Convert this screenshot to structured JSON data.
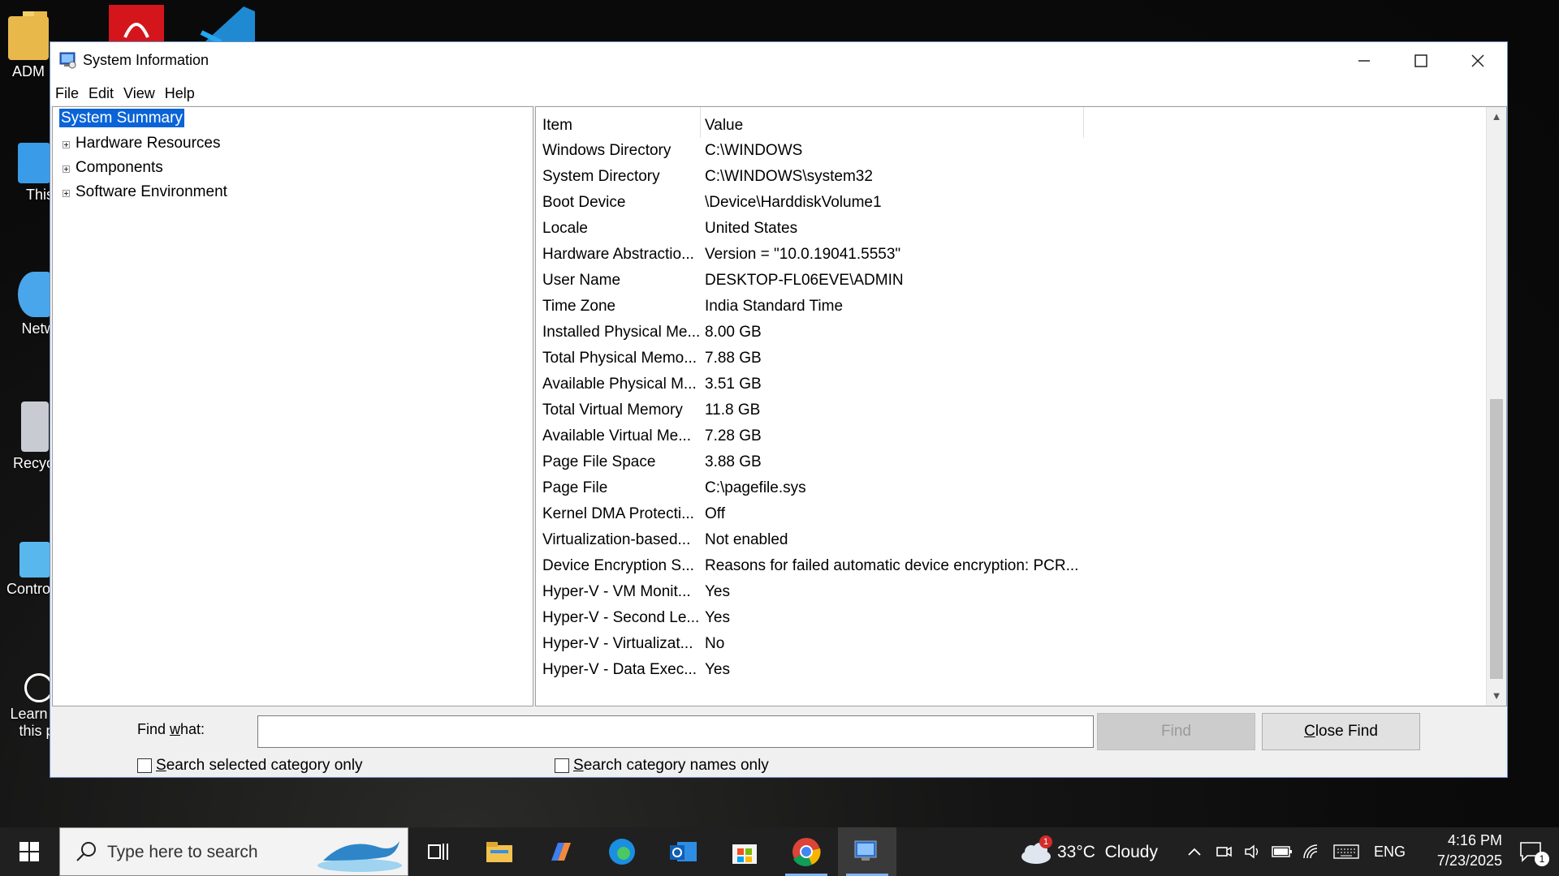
{
  "desktop": {
    "icons": [
      {
        "label": "ADM",
        "icon": "user-folder-icon"
      },
      {
        "label": "This",
        "icon": "this-pc-icon"
      },
      {
        "label": "Netw",
        "icon": "network-icon"
      },
      {
        "label": "Recycl",
        "icon": "recycle-bin-icon"
      },
      {
        "label": "Control",
        "icon": "control-panel-icon"
      },
      {
        "label": "Learn a",
        "label2": "this pi",
        "icon": "learn-about-picture-icon"
      }
    ]
  },
  "window": {
    "title": "System Information",
    "menu": [
      "File",
      "Edit",
      "View",
      "Help"
    ],
    "tree": [
      {
        "label": "System Summary",
        "selected": true,
        "expandable": false
      },
      {
        "label": "Hardware Resources",
        "expandable": true
      },
      {
        "label": "Components",
        "expandable": true
      },
      {
        "label": "Software Environment",
        "expandable": true
      }
    ],
    "columns": {
      "item": "Item",
      "value": "Value"
    },
    "rows": [
      {
        "item": "Windows Directory",
        "value": "C:\\WINDOWS"
      },
      {
        "item": "System Directory",
        "value": "C:\\WINDOWS\\system32"
      },
      {
        "item": "Boot Device",
        "value": "\\Device\\HarddiskVolume1"
      },
      {
        "item": "Locale",
        "value": "United States"
      },
      {
        "item": "Hardware Abstractio...",
        "value": "Version = \"10.0.19041.5553\""
      },
      {
        "item": "User Name",
        "value": "DESKTOP-FL06EVE\\ADMIN"
      },
      {
        "item": "Time Zone",
        "value": "India Standard Time"
      },
      {
        "item": "Installed Physical Me...",
        "value": "8.00 GB"
      },
      {
        "item": "Total Physical Memo...",
        "value": "7.88 GB"
      },
      {
        "item": "Available Physical M...",
        "value": "3.51 GB"
      },
      {
        "item": "Total Virtual Memory",
        "value": "11.8 GB"
      },
      {
        "item": "Available Virtual Me...",
        "value": "7.28 GB"
      },
      {
        "item": "Page File Space",
        "value": "3.88 GB"
      },
      {
        "item": "Page File",
        "value": "C:\\pagefile.sys"
      },
      {
        "item": "Kernel DMA Protecti...",
        "value": "Off"
      },
      {
        "item": "Virtualization-based...",
        "value": "Not enabled"
      },
      {
        "item": "Device Encryption S...",
        "value": "Reasons for failed automatic device encryption: PCR..."
      },
      {
        "item": "Hyper-V - VM Monit...",
        "value": "Yes"
      },
      {
        "item": "Hyper-V - Second Le...",
        "value": "Yes"
      },
      {
        "item": "Hyper-V - Virtualizat...",
        "value": "No"
      },
      {
        "item": "Hyper-V - Data Exec...",
        "value": "Yes"
      }
    ],
    "find": {
      "label_pre": "Find ",
      "label_accel": "w",
      "label_post": "hat:",
      "value": "",
      "find_button": "Find",
      "close_accel": "C",
      "close_rest": "lose Find",
      "check1_accel": "S",
      "check1_rest": "earch selected category only",
      "check2_accel": "S",
      "check2_rest": "earch category names only"
    }
  },
  "taskbar": {
    "search_placeholder": "Type here to search",
    "weather": "33°C  Cloudy",
    "weather_badge": "1",
    "language": "ENG",
    "time": "4:16 PM",
    "date": "7/23/2025",
    "notification_count": "1"
  },
  "colors": {
    "selection": "#0a64d7",
    "taskbar": "#202020",
    "window_border": "#6b8ebf"
  }
}
